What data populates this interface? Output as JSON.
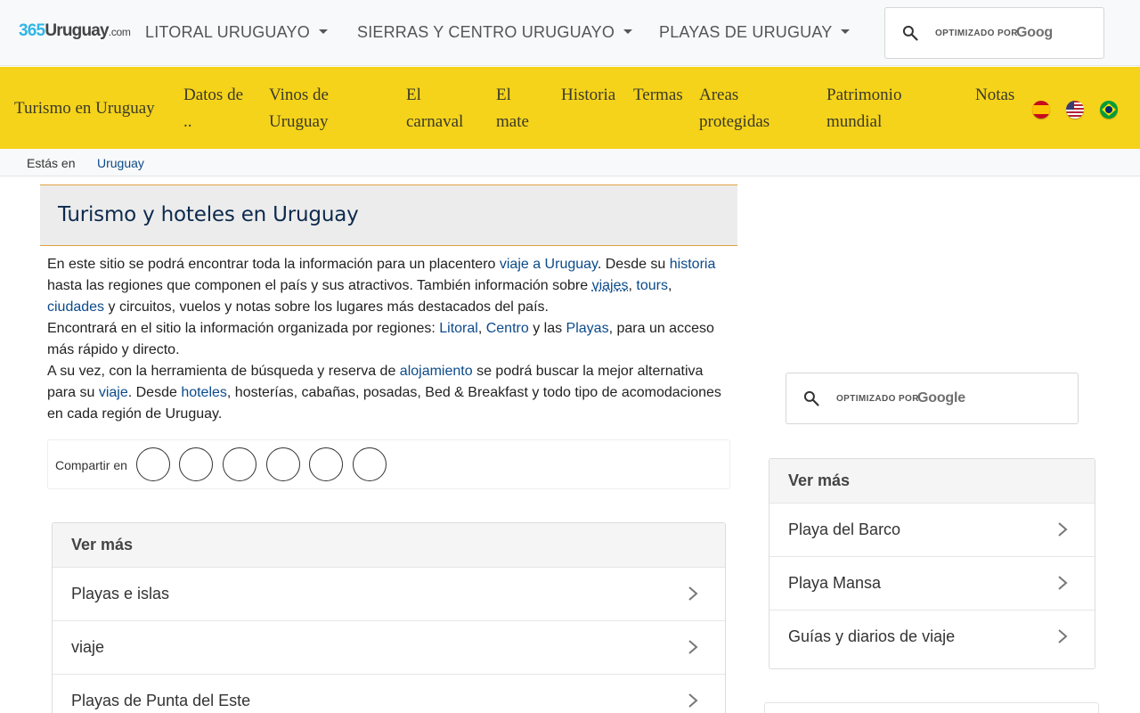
{
  "header": {
    "logo": {
      "number": "365",
      "name": "Uruguay",
      "domain": ".com"
    },
    "nav": [
      {
        "label": "LITORAL URUGUAYO"
      },
      {
        "label": "SIERRAS Y CENTRO URUGUAYO"
      },
      {
        "label": "PLAYAS DE URUGUAY"
      }
    ],
    "search": {
      "powered": "OPTIMIZADO POR",
      "brand": "Goog"
    }
  },
  "menu": {
    "items": [
      {
        "label": "Turismo en Uruguay"
      },
      {
        "label": "Datos de\n.."
      },
      {
        "label": "Vinos de\nUruguay"
      },
      {
        "label": "El\ncarnaval"
      },
      {
        "label": "El\nmate"
      },
      {
        "label": "Historia"
      },
      {
        "label": "Termas"
      },
      {
        "label": "Areas\nprotegidas"
      },
      {
        "label": "Patrimonio\nmundial"
      },
      {
        "label": "Notas"
      }
    ],
    "flags": [
      "spain-flag-icon",
      "usa-flag-icon",
      "brazil-flag-icon"
    ]
  },
  "breadcrumb": {
    "label": "Estás en",
    "sep_icon": "home-icon",
    "sep": "",
    "link": "Uruguay"
  },
  "page": {
    "title": "Turismo y hoteles en Uruguay"
  },
  "body": {
    "p1_a": "En este sitio se podrá encontrar toda la información para un placentero ",
    "p1_link1": "viaje a Uruguay",
    "p1_b": ". Desde su ",
    "p1_link2": "historia",
    "p1_c": " hasta las regiones que componen el país y sus atractivos. También información sobre ",
    "p1_icon": "",
    "p1_link3": "viajes",
    "p1_d": ", ",
    "p1_link4": "tours",
    "p1_e": ", ",
    "p1_link5": "ciudades",
    "p1_f": " y circuitos, vuelos y notas sobre los lugares más destacados del país.",
    "p2_a": "Encontrará en el sitio la información organizada por regiones: ",
    "p2_link1": "Litoral",
    "p2_b": ", ",
    "p2_link2": "Centro",
    "p2_c": " y las ",
    "p2_link3": "Playas",
    "p2_d": ", para un acceso más rápido y directo.",
    "p3_a": "A su vez, con la herramienta de búsqueda y reserva de ",
    "p3_link1": "alojamiento",
    "p3_b": " se podrá buscar la mejor alternativa para su ",
    "p3_link2": "viaje",
    "p3_c": ". Desde ",
    "p3_link3": "hoteles",
    "p3_d": ", hosterías, cabañas, posadas, Bed & Breakfast y todo tipo de acomodaciones en cada región de Uruguay."
  },
  "share": {
    "label": "Compartir en",
    "buttons": [
      {
        "icon": "facebook-icon",
        "glyph": ""
      },
      {
        "icon": "twitter-icon",
        "glyph": ""
      },
      {
        "icon": "whatsapp-icon",
        "glyph": ""
      },
      {
        "icon": "pinterest-icon",
        "glyph": ""
      },
      {
        "icon": "telegram-icon",
        "glyph": ""
      },
      {
        "icon": "email-icon",
        "glyph": ""
      }
    ]
  },
  "sidebar_search": {
    "powered": "OPTIMIZADO POR",
    "brand": "Google"
  },
  "main_more": {
    "title": "Ver más",
    "items": [
      {
        "label": "Playas e islas"
      },
      {
        "label": "viaje"
      },
      {
        "label": "Playas de Punta del Este"
      }
    ]
  },
  "side_more": {
    "title": "Ver más",
    "items": [
      {
        "label": "Playa del Barco"
      },
      {
        "label": "Playa Mansa"
      },
      {
        "label": "Guías y diarios de viaje"
      }
    ]
  },
  "colors": {
    "menu_bg": "#f5d31a",
    "link": "#0b4a8a",
    "title": "#0d2a4d",
    "logo_accent": "#31b6e6"
  }
}
